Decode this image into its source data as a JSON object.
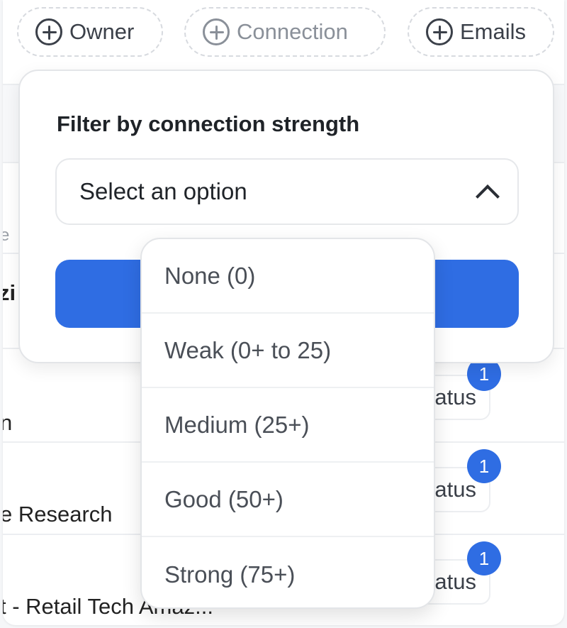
{
  "chips": {
    "owner": "Owner",
    "connection": "Connection",
    "emails": "Emails"
  },
  "background": {
    "header_fragment": "e",
    "row_fragment_1": "zi",
    "row_fragment_2": "n",
    "row_fragment_3": "e Research",
    "row_fragment_4": "t - Retail Tech Amaz...",
    "status_label": "atus",
    "badge_count": "1"
  },
  "popover": {
    "title": "Filter by connection strength",
    "select_placeholder": "Select an option"
  },
  "options": [
    "None (0)",
    "Weak (0+ to 25)",
    "Medium (25+)",
    "Good (50+)",
    "Strong (75+)"
  ],
  "colors": {
    "accent": "#2f6de3",
    "badge": "#2f6de3"
  }
}
